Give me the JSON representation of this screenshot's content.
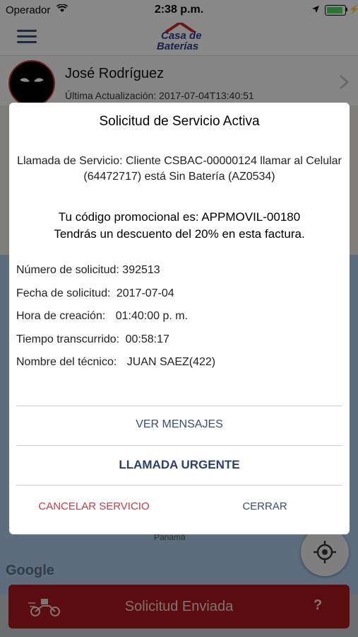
{
  "status_bar": {
    "carrier": "Operador",
    "time": "2:38 p.m."
  },
  "nav": {
    "logo_line1": "Casa de",
    "logo_line2": "Baterías"
  },
  "profile": {
    "name": "José Rodríguez",
    "last_update": "Última Actualización: 2017-07-04T13:40:51"
  },
  "map": {
    "watermark": "Google",
    "place_label": "Panamá"
  },
  "dialog": {
    "title": "Solicitud de Servicio Activa",
    "message": "Llamada de Servicio: Cliente CSBAC-00000124 llamar al Celular (64472717) está Sin Batería (AZ0534)",
    "promo_line1": "Tu código promocional es: APPMOVIL-00180",
    "promo_line2": "Tendrás un descuento del 20% en esta factura.",
    "details": [
      {
        "label": "Número de solicitud:",
        "value": "392513"
      },
      {
        "label": "Fecha de solicitud:",
        "value": "2017-07-04"
      },
      {
        "label": "Hora de creación:",
        "value": "01:40:00 p. m."
      },
      {
        "label": "Tiempo transcurrido:",
        "value": "00:58:17"
      },
      {
        "label": "Nombre del técnico:",
        "value": "JUAN SAEZ(422)"
      }
    ],
    "buttons": {
      "messages": "VER MENSAJES",
      "urgent": "LLAMADA URGENTE",
      "cancel": "CANCELAR SERVICIO",
      "close": "CERRAR"
    }
  },
  "bottom_bar": {
    "label": "Solicitud Enviada",
    "help": "?",
    "color": "#a6161a"
  },
  "icons": [
    "wifi-icon",
    "location-arrow-icon",
    "battery-icon",
    "menu-icon",
    "chevron-right-icon",
    "locate-icon",
    "motorcycle-delivery-icon",
    "help-icon"
  ]
}
